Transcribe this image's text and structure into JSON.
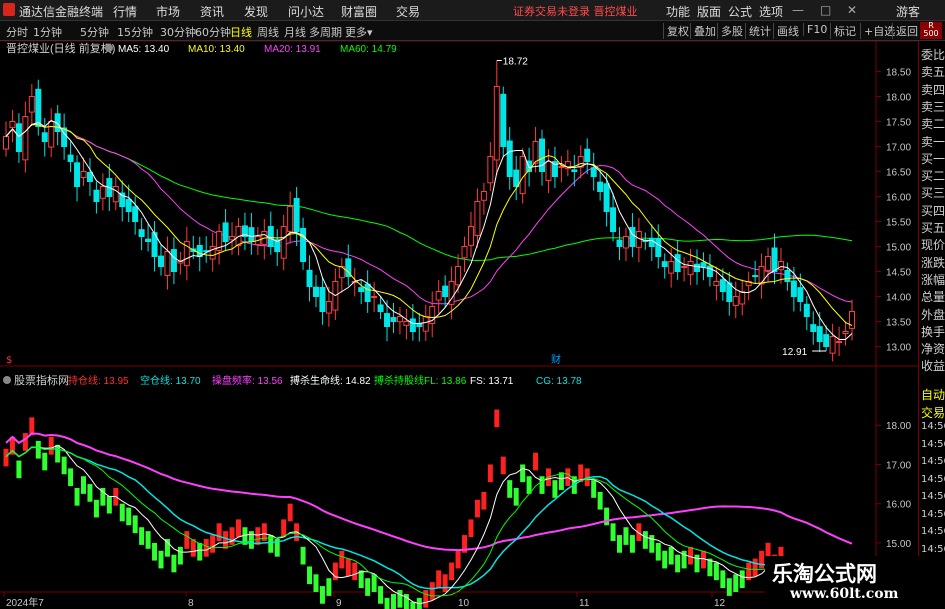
{
  "menu": {
    "app_name": "通达信金融终端",
    "items": [
      "行情",
      "市场",
      "资讯",
      "发现",
      "问小达",
      "财富圈",
      "交易"
    ],
    "warning": "证券交易未登录  晋控煤业",
    "right_items": [
      "功能",
      "版面",
      "公式",
      "选项"
    ],
    "guest": "游客"
  },
  "toolbar": {
    "periods": [
      "分时",
      "1分钟",
      "5分钟",
      "15分钟",
      "30分钟",
      "60分钟",
      "日线",
      "周线",
      "月线",
      "多周期",
      "更多▾"
    ],
    "active": "日线",
    "right_buttons": [
      "复权",
      "叠加",
      "多股",
      "统计",
      "画线",
      "F10",
      "标记",
      "+自选",
      "返回"
    ]
  },
  "main_chart": {
    "stock_label": "晋控煤业(日线 前复权)",
    "ma_legend": [
      {
        "label": "MA5: 13.40",
        "color": "#ffffff"
      },
      {
        "label": "MA10: 13.40",
        "color": "#ffff00"
      },
      {
        "label": "MA20: 13.91",
        "color": "#ff40ff"
      },
      {
        "label": "MA60: 14.79",
        "color": "#00ff00"
      }
    ],
    "high_label": "18.72",
    "low_label": "12.91",
    "y_ticks": [
      "18.50",
      "18.00",
      "17.50",
      "17.00",
      "16.50",
      "16.00",
      "15.50",
      "15.00",
      "14.50",
      "14.00",
      "13.50",
      "13.00"
    ],
    "y_range": [
      12.75,
      18.95
    ],
    "marker_cai": "财",
    "marker_s": "$"
  },
  "sub_chart": {
    "indicator_name": "股票指标网",
    "legend": [
      {
        "label": "持仓线: 13.95",
        "color": "#ff3030"
      },
      {
        "label": "空仓线: 13.70",
        "color": "#00e5e5"
      },
      {
        "label": "操盘频率: 13.56",
        "color": "#ff40ff"
      },
      {
        "label": "搏杀生命线: 14.82",
        "color": "#ffffff"
      },
      {
        "label": "搏杀持股线FL: 13.86",
        "color": "#00ff00"
      },
      {
        "label": "FS: 13.71",
        "color": "#ffffff"
      },
      {
        "label": "CG: 13.78",
        "color": "#00e5e5"
      }
    ],
    "y_ticks": [
      "18.00",
      "17.00",
      "16.00",
      "15.00"
    ],
    "y_range": [
      13.8,
      19.0
    ]
  },
  "date_axis": [
    "2024年7",
    "8",
    "9",
    "10",
    "11",
    "12"
  ],
  "right_panel": {
    "badge": "R 500",
    "items": [
      "委比",
      "卖五",
      "卖四",
      "卖三",
      "卖二",
      "卖一",
      "买一",
      "买二",
      "买三",
      "买四",
      "买五",
      "现价",
      "涨跌",
      "涨幅",
      "总量",
      "外盘",
      "换手",
      "净资",
      "收益"
    ],
    "sub_items": [
      "自动",
      "交易",
      "14:56",
      "14:56",
      "14:56",
      "14:56",
      "14:56",
      "14:56",
      "14:56",
      "14:56"
    ]
  },
  "watermark": {
    "line1": "乐淘公式网",
    "line2": "www.60lt.com"
  },
  "colors": {
    "up": "#ff3b3b",
    "down": "#00e5e5",
    "ma5": "#ffffff",
    "ma10": "#ffff00",
    "ma20": "#ff40ff",
    "ma60": "#00ff00",
    "grid": "#7a0000"
  },
  "chart_data": {
    "type": "candlestick",
    "closes": [
      17.2,
      17.5,
      16.9,
      17.6,
      18.0,
      17.4,
      17.1,
      17.5,
      17.3,
      17.0,
      16.7,
      16.2,
      16.5,
      16.3,
      15.9,
      16.2,
      16.0,
      16.2,
      15.8,
      15.7,
      15.5,
      15.2,
      15.1,
      14.8,
      14.6,
      14.9,
      14.5,
      14.7,
      15.1,
      14.9,
      14.8,
      14.9,
      15.0,
      15.3,
      15.1,
      15.2,
      15.4,
      15.2,
      15.1,
      15.2,
      15.3,
      15.0,
      14.9,
      15.4,
      15.8,
      15.3,
      14.7,
      14.2,
      14.0,
      13.7,
      13.9,
      14.3,
      14.6,
      14.4,
      14.3,
      14.1,
      13.9,
      14.0,
      13.7,
      13.4,
      13.5,
      13.6,
      13.5,
      13.3,
      13.4,
      13.6,
      13.8,
      14.1,
      14.0,
      14.3,
      14.6,
      15.0,
      15.4,
      15.9,
      16.1,
      16.8,
      18.2,
      17.0,
      16.4,
      16.2,
      16.8,
      16.5,
      17.1,
      16.5,
      16.7,
      16.4,
      16.6,
      16.7,
      16.5,
      16.8,
      16.7,
      16.4,
      16.1,
      15.7,
      15.3,
      15.0,
      15.2,
      15.0,
      15.3,
      15.1,
      15.0,
      14.8,
      14.6,
      14.7,
      14.5,
      14.6,
      14.7,
      14.5,
      14.6,
      14.4,
      14.3,
      14.1,
      13.9,
      14.0,
      14.1,
      14.3,
      14.4,
      14.6,
      14.8,
      14.5,
      14.7,
      14.3,
      14.0,
      13.9,
      13.6,
      13.3,
      13.1,
      13.0,
      13.2,
      13.1,
      13.3,
      13.7
    ],
    "high": 18.72,
    "low": 12.91,
    "last": {
      "ma5": 13.4,
      "ma10": 13.4,
      "ma20": 13.91,
      "ma60": 14.79
    }
  }
}
